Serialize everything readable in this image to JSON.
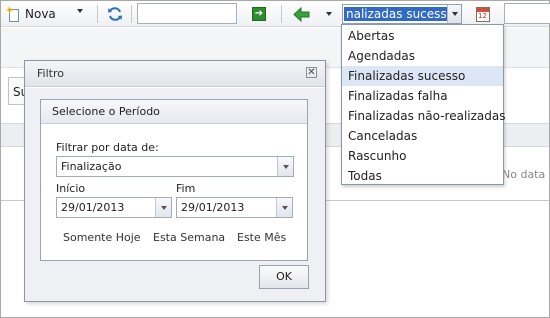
{
  "toolbar": {
    "new_label": "Nova",
    "search_value": "",
    "period_selected": "nalizadas sucesso",
    "right_input_value": ""
  },
  "background": {
    "tab_label": "Su",
    "no_data_text": "No data"
  },
  "dialog": {
    "title": "Filtro",
    "group_title": "Selecione o Período",
    "filter_label": "Filtrar por data de:",
    "filter_value": "Finalização",
    "start_label": "Início",
    "start_value": "29/01/2013",
    "end_label": "Fim",
    "end_value": "29/01/2013",
    "quick": {
      "today": "Somente Hoje",
      "week": "Esta Semana",
      "month": "Este Mês"
    },
    "ok_label": "OK"
  },
  "dropdown": {
    "items": [
      "Abertas",
      "Agendadas",
      "Finalizadas sucesso",
      "Finalizadas falha",
      "Finalizadas não-realizadas",
      "Canceladas",
      "Rascunho",
      "Todas"
    ],
    "selected": "Finalizadas sucesso"
  },
  "colors": {
    "selection_highlight": "#316ac5",
    "hover_item": "#dce6f4",
    "go_button": "#2e8b2e",
    "back_arrow": "#3aa13a"
  }
}
